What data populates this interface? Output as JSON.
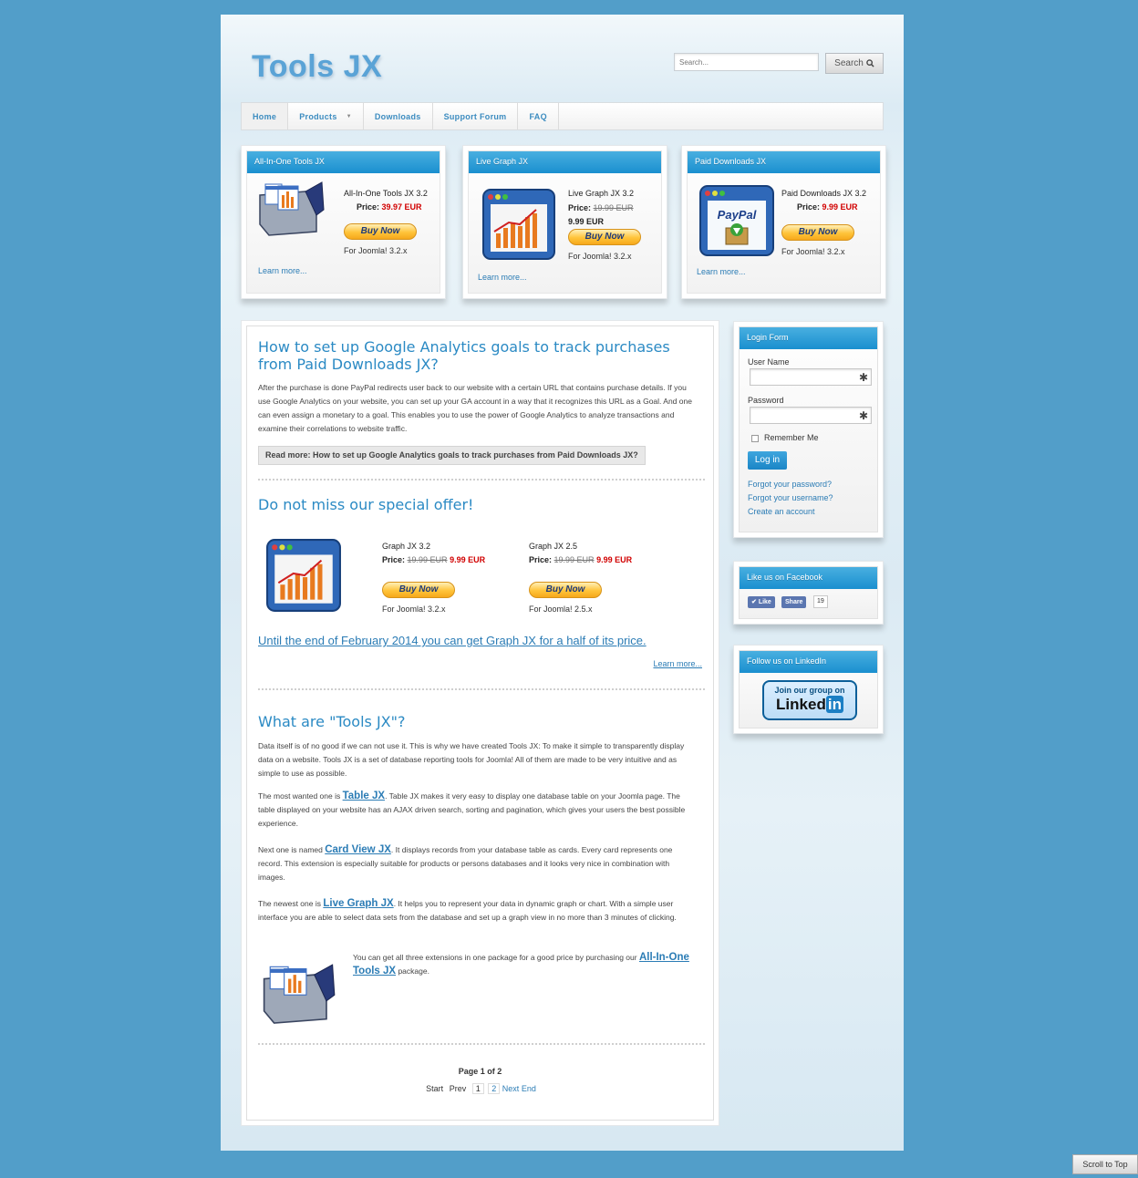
{
  "header": {
    "logo": "Tools JX",
    "search_placeholder": "Search...",
    "search_button": "Search"
  },
  "nav": [
    "Home",
    "Products",
    "Downloads",
    "Support Forum",
    "FAQ"
  ],
  "promos": [
    {
      "title": "All-In-One Tools JX",
      "name": "All-In-One Tools JX 3.2",
      "price_label": "Price:",
      "price": "39.97 EUR",
      "buy": "Buy Now",
      "joomla": "For Joomla! 3.2.x",
      "learn": "Learn more..."
    },
    {
      "title": "Live Graph JX",
      "name": "Live Graph JX 3.2",
      "price_label": "Price:",
      "old_price": "19.99 EUR",
      "price": "9.99 EUR",
      "buy": "Buy Now",
      "joomla": "For Joomla! 3.2.x",
      "learn": "Learn more..."
    },
    {
      "title": "Paid Downloads JX",
      "name": "Paid Downloads JX 3.2",
      "price_label": "Price:",
      "price": "9.99 EUR",
      "buy": "Buy Now",
      "joomla": "For Joomla! 3.2.x",
      "learn": "Learn more..."
    }
  ],
  "article1": {
    "title": "How to set up Google Analytics goals to track purchases from Paid Downloads JX?",
    "body": "After the purchase is done PayPal redirects user back to our website with a certain URL that contains purchase details. If you use Google Analytics on your website, you can set up your GA account in a way that it recognizes this URL as a Goal. And one can even assign a monetary to a goal.  This enables you to use the power of Google Analytics to analyze transactions and examine their correlations to website traffic.",
    "read_more": "Read more: How to set up Google Analytics goals to track purchases from Paid Downloads JX?"
  },
  "article2": {
    "title": "Do not miss our special offer!",
    "products": [
      {
        "name": "Graph JX 3.2",
        "price_label": "Price:",
        "old_price": "19.99 EUR",
        "price": "9.99 EUR",
        "buy": "Buy Now",
        "joomla": "For Joomla! 3.2.x"
      },
      {
        "name": "Graph JX 2.5",
        "price_label": "Price:",
        "old_price": "19.99 EUR",
        "price": "9.99 EUR",
        "buy": "Buy Now",
        "joomla": "For Joomla! 2.5.x"
      }
    ],
    "offer_link": "Until the end of February 2014 you can get Graph JX for a half of its price.",
    "learn": "Learn more..."
  },
  "article3": {
    "title": "What are \"Tools JX\"?",
    "p1": "Data itself is of no good if we can not use it. This is why we have created Tools JX: To make it simple to transparently display data on a website. Tools JX is a set of database reporting tools for Joomla! All of them are made to be very intuitive and as simple to use as possible.",
    "p2_pre": "The most wanted one is ",
    "p2_link": "Table JX",
    "p2_post": ". Table JX makes it very easy to display one database table on your Joomla page. The table displayed on your website has an AJAX driven search, sorting and pagination, which gives your users the best possible experience.",
    "p3_pre": "Next one is named ",
    "p3_link": "Card View JX",
    "p3_post": ". It displays records from your database table as cards. Every card represents one record. This extension is especially suitable for products or persons databases and it looks very nice in combination with images.",
    "p4_pre": "The newest one is ",
    "p4_link": "Live Graph JX",
    "p4_post": ". It helps you to represent your data in dynamic graph or chart. With a simple user interface you are able to select data sets from the database and set up a graph view in no more than 3 minutes of clicking.",
    "p5_pre": "You can get all three extensions in one package for a good price by purchasing our ",
    "p5_link": "All-In-One Tools JX",
    "p5_post": " package."
  },
  "pagination": {
    "info": "Page 1 of 2",
    "start": "Start",
    "prev": "Prev",
    "pages": [
      "1",
      "2"
    ],
    "next": "Next",
    "end": "End"
  },
  "login": {
    "title": "Login Form",
    "username_label": "User Name",
    "password_label": "Password",
    "remember": "Remember Me",
    "button": "Log in",
    "forgot_password": "Forgot your password?",
    "forgot_username": "Forgot your username?",
    "create": "Create an account"
  },
  "facebook": {
    "title": "Like us on Facebook",
    "like": "Like",
    "share": "Share",
    "count": "19"
  },
  "linkedin": {
    "title": "Follow us on LinkedIn",
    "join": "Join our group on",
    "brand_a": "Linked",
    "brand_b": "in"
  },
  "scroll_top": "Scroll to Top"
}
